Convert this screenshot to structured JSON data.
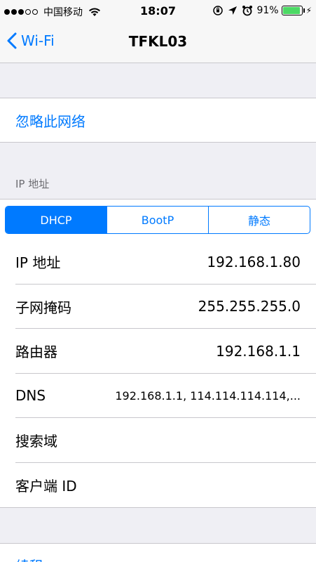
{
  "status_bar": {
    "carrier": "中国移动",
    "time": "18:07",
    "battery_percent": "91%",
    "battery_level": 0.91,
    "signal_filled": 3,
    "signal_total": 5
  },
  "nav": {
    "back_label": "Wi-Fi",
    "title": "TFKL03"
  },
  "forget_network": "忽略此网络",
  "ip_section_header": "IP 地址",
  "segments": [
    {
      "label": "DHCP",
      "selected": true
    },
    {
      "label": "BootP",
      "selected": false
    },
    {
      "label": "静态",
      "selected": false
    }
  ],
  "rows": [
    {
      "label": "IP 地址",
      "value": "192.168.1.80"
    },
    {
      "label": "子网掩码",
      "value": "255.255.255.0"
    },
    {
      "label": "路由器",
      "value": "192.168.1.1"
    },
    {
      "label": "DNS",
      "value": "192.168.1.1, 114.114.114.114,..."
    },
    {
      "label": "搜索域",
      "value": ""
    },
    {
      "label": "客户端 ID",
      "value": ""
    }
  ],
  "renew_lease": "续租",
  "colors": {
    "accent": "#007aff",
    "background": "#efeff4",
    "battery": "#4cd964"
  }
}
